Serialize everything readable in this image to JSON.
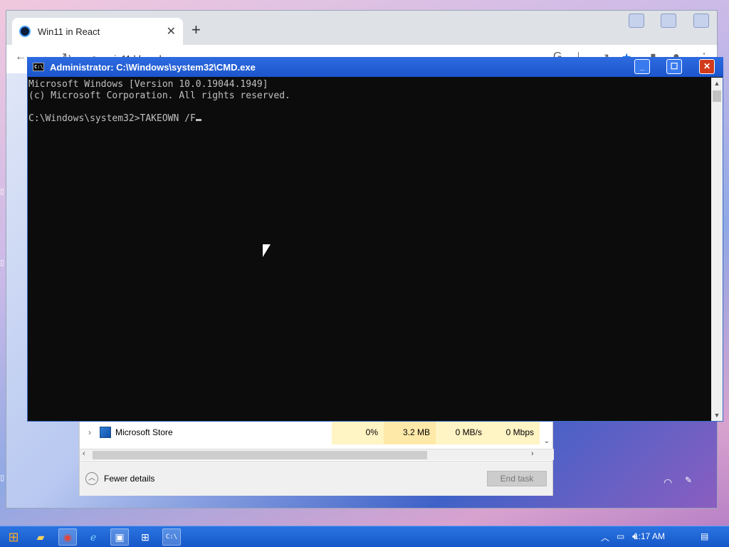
{
  "browser": {
    "tab_title": "Win11 in React",
    "url": "win11.blueedge.me"
  },
  "task_manager": {
    "row": {
      "name": "Microsoft Store",
      "cpu": "0%",
      "memory": "3.2 MB",
      "disk": "0 MB/s",
      "network": "0 Mbps"
    },
    "fewer_details_label": "Fewer details",
    "end_task_label": "End task"
  },
  "cmd": {
    "title": "Administrator: C:\\Windows\\system32\\CMD.exe",
    "lines": [
      "Microsoft Windows [Version 10.0.19044.1949]",
      "(c) Microsoft Corporation. All rights reserved.",
      "",
      "C:\\Windows\\system32>TAKEOWN /F"
    ]
  },
  "taskbar": {
    "clock": "1:17 AM",
    "pinned": [
      "start-button",
      "file-explorer",
      "chrome",
      "internet-explorer",
      "control-panel",
      "microsoft-store",
      "cmd"
    ]
  }
}
